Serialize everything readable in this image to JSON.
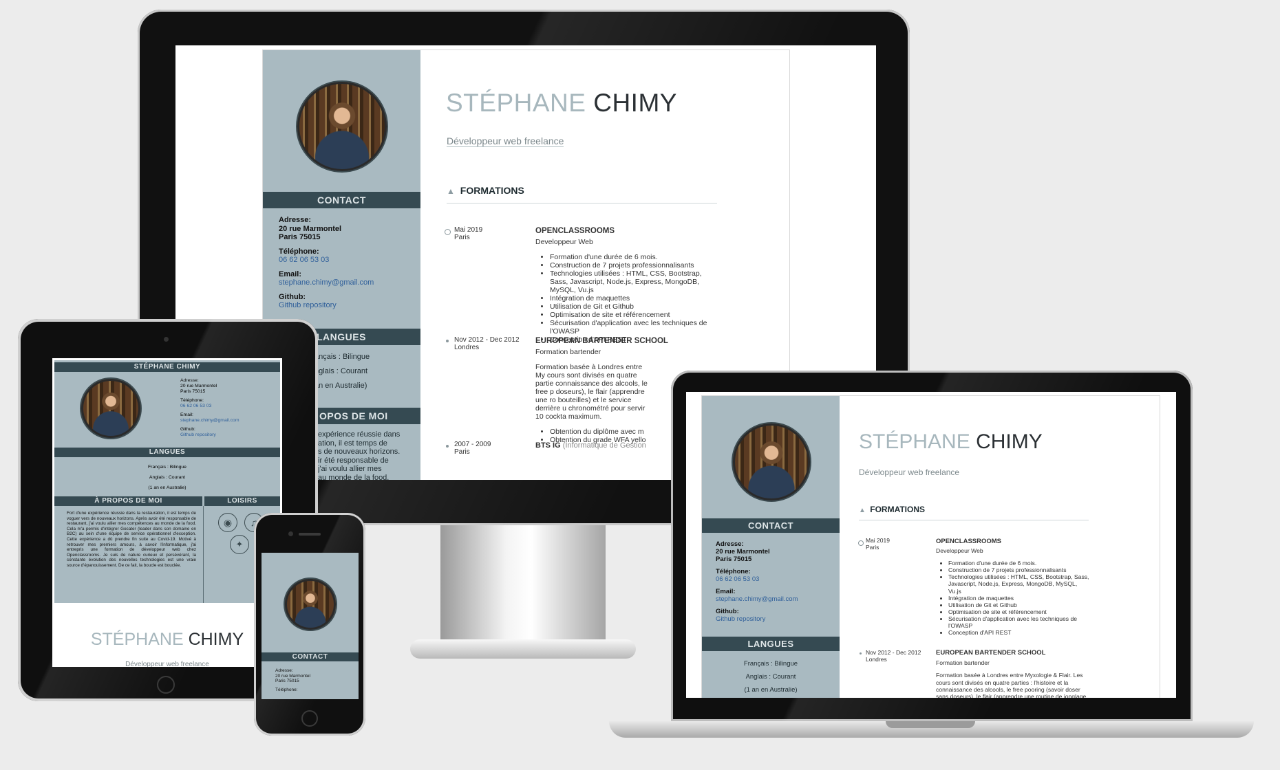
{
  "cv": {
    "first_name": "STÉPHANE",
    "last_name": "CHIMY",
    "subtitle": "Développeur web freelance",
    "contact_title": "CONTACT",
    "address_label": "Adresse:",
    "address_line1": "20 rue Marmontel",
    "address_line2": "Paris 75015",
    "phone_label": "Téléphone:",
    "phone": "06 62 06 53 03",
    "email_label": "Email:",
    "email": "stephane.chimy@gmail.com",
    "github_label": "Github:",
    "github": "Github repository",
    "languages_title": "LANGUES",
    "lang_fr": "Français : Bilingue",
    "lang_en": "Anglais : Courant",
    "lang_note": "(1 an en Australie)",
    "about_title": "À PROPOS DE MOI",
    "hobbies_title": "LOISIRS",
    "about_text": "Fort d'une expérience réussie dans la restauration, il est temps de voguer vers de nouveaux horizons. Après avoir été responsable de restaurant, j'ai voulu allier mes compétences au monde de la food. Cela m'a permis d'intégrer Gocater (leader dans son domaine en B2C) au sein d'une équipe de service opérationnel d'exception. Cette expérience a dû prendre fin suite au Covid-19. Motivé à retrouver mes premiers amours, à savoir l'informatique, j'ai entrepris une formation de développeur web chez Openclassrooms. Je suis de nature curieux et persévérant, la constante évolution des nouvelles technologies est une vraie source d'épanouissement. De ce fait, la boucle est bouclée.",
    "formations_title": "FORMATIONS",
    "entries": [
      {
        "date": "Mai 2019",
        "place": "Paris",
        "school": "OPENCLASSROOMS",
        "role": "Developpeur Web",
        "bullets": [
          "Formation d'une durée de 6 mois.",
          "Construction de 7 projets professionnalisants",
          "Technologies utilisées : HTML, CSS, Bootstrap, Sass, Javascript, Node.js, Express, MongoDB, MySQL, Vu.js",
          "Intégration de maquettes",
          "Utilisation de Git et Github",
          "Optimisation de site et référencement",
          "Sécurisation d'application avec les techniques de l'OWASP",
          "Conception d'API REST"
        ]
      },
      {
        "date": "Nov 2012 - Dec 2012",
        "place": "Londres",
        "school": "EUROPEAN BARTENDER SCHOOL",
        "role": "Formation bartender",
        "desc": "Formation basée à Londres entre Myxologie & Flair. Les cours sont divisés en quatre parties : l'histoire et la connaissance des alcools, le free pooring (savoir doser sans doseurs), le flair (apprendre une routine de jonglage avec les bouteilles) et le service derrière un bar (savoir être chronométré pour servir 10 cocktails en un temps maximum.",
        "desc_desktop": "Formation basée à Londres entre My cours sont divisés en quatre partie connaissance des alcools, le free p doseurs), le flair (apprendre une ro bouteilles) et le service derrière u chronométré pour servir 10 cockta maximum.",
        "bullets": [
          "Obtention du diplôme avec m",
          "Obtention du grade WFA yello"
        ]
      },
      {
        "date": "2007 - 2009",
        "place": "Paris",
        "school": "BTS IG",
        "school_extra": "(Informatique de Gestion"
      }
    ],
    "desktop_lang_fr": "ançais : Bilingue",
    "desktop_lang_en": "nglais : Courant",
    "desktop_lang_note": "an en Australie)",
    "desktop_about_title": "OPOS DE MOI",
    "desktop_about_lines": [
      "expérience réussie dans",
      "ation, il est temps de",
      "s de nouveaux horizons.",
      "ir été responsable de",
      "j'ai voulu allier mes",
      "au monde de la food."
    ]
  },
  "colors": {
    "sidebar": "#a9bac1",
    "band": "#354a52",
    "link": "#2f5f9a",
    "name_light": "#a7b7bd"
  }
}
